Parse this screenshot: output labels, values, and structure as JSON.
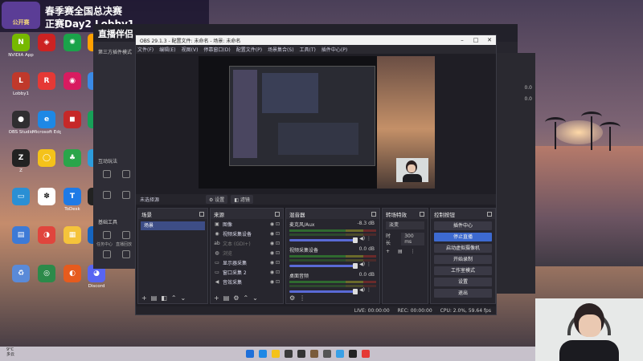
{
  "overlay": {
    "logo_text": "公开赛",
    "title_line1": "春季赛全国总决赛",
    "title_line2": "正赛Day2 Lobby1"
  },
  "desktop_icons": [
    {
      "label": "NVIDIA App",
      "color": "#76b900",
      "glyph": "N"
    },
    {
      "label": "Lobby1",
      "color": "#c0392b",
      "glyph": "L"
    },
    {
      "label": "OBS Studio",
      "color": "#302e31",
      "glyph": "●"
    },
    {
      "label": "Z",
      "color": "#222222",
      "glyph": "Z"
    },
    {
      "label": "",
      "color": "#2a8fd4",
      "glyph": "▭"
    },
    {
      "label": "",
      "color": "#3d7ad6",
      "glyph": "▤"
    },
    {
      "label": "",
      "color": "#5a8ad8",
      "glyph": "♻"
    },
    {
      "label": "",
      "color": "#cc2222",
      "glyph": "◈"
    },
    {
      "label": "",
      "color": "#e53935",
      "glyph": "R"
    },
    {
      "label": "Microsoft Edge",
      "color": "#1e88e5",
      "glyph": "e"
    },
    {
      "label": "",
      "color": "#f4c21a",
      "glyph": "◯"
    },
    {
      "label": "",
      "color": "#ffffff",
      "glyph": "✽"
    },
    {
      "label": "",
      "color": "#e0453d",
      "glyph": "◑"
    },
    {
      "label": "",
      "color": "#2c8a4a",
      "glyph": "◎"
    },
    {
      "label": "",
      "color": "#1aa34a",
      "glyph": "✺"
    },
    {
      "label": "",
      "color": "#d81b60",
      "glyph": "◉"
    },
    {
      "label": "",
      "color": "#c62828",
      "glyph": "◼"
    },
    {
      "label": "",
      "color": "#2aa54a",
      "glyph": "♣"
    },
    {
      "label": "ToDesk",
      "color": "#1e7ae6",
      "glyph": "T"
    },
    {
      "label": "",
      "color": "#f5c33b",
      "glyph": "▦"
    },
    {
      "label": "",
      "color": "#e65b1e",
      "glyph": "◐"
    },
    {
      "label": "",
      "color": "#ffa000",
      "glyph": "★"
    },
    {
      "label": "",
      "color": "#3a8ae6",
      "glyph": "K"
    },
    {
      "label": "",
      "color": "#18a058",
      "glyph": "▩"
    },
    {
      "label": "",
      "color": "#2d9cdb",
      "glyph": "◆"
    },
    {
      "label": "",
      "color": "#222222",
      "glyph": "◒"
    },
    {
      "label": "",
      "color": "#1565c0",
      "glyph": "◀"
    },
    {
      "label": "Discord",
      "color": "#5865f2",
      "glyph": "◕"
    }
  ],
  "bg_app": {
    "logo": "直播伴侣",
    "menu_label": "第三方插件模式",
    "section_interact": "互动玩法",
    "section_tools": "基础工具",
    "tool_labels": [
      "任务中心",
      "直播回放"
    ]
  },
  "obs": {
    "title": "OBS 29.1.3 - 配置文件: 未命名 - 场景: 未命名",
    "menu": [
      "文件(F)",
      "编辑(E)",
      "视图(V)",
      "停靠窗口(D)",
      "配置文件(P)",
      "场景集合(S)",
      "工具(T)",
      "插件中心(P)"
    ],
    "status_strip": {
      "label": "未选择源",
      "settings": "设置",
      "filters": "滤镜"
    },
    "scenes": {
      "header": "场景",
      "items": [
        "场景"
      ]
    },
    "sources": {
      "header": "来源",
      "items": [
        {
          "icon": "image-icon",
          "glyph": "▣",
          "name": "图像",
          "dim": false
        },
        {
          "icon": "camera-icon",
          "glyph": "◉",
          "name": "视频采集设备",
          "dim": false
        },
        {
          "icon": "text-icon",
          "glyph": "ab",
          "name": "文本 (GDI+)",
          "dim": true
        },
        {
          "icon": "browser-icon",
          "glyph": "◍",
          "name": "浏览",
          "dim": true
        },
        {
          "icon": "monitor-icon",
          "glyph": "▭",
          "name": "显示器采集",
          "dim": false
        },
        {
          "icon": "window-icon",
          "glyph": "▭",
          "name": "窗口采集 2",
          "dim": false
        },
        {
          "icon": "speaker-icon",
          "glyph": "◀",
          "name": "音效采集",
          "dim": false
        }
      ]
    },
    "mixer": {
      "header": "混音器",
      "channels": [
        {
          "name": "麦克风/Aux",
          "db": "-8.3 dB"
        },
        {
          "name": "视频采集设备",
          "db": "0.0 dB"
        },
        {
          "name": "桌面音频",
          "db": "0.0 dB"
        }
      ]
    },
    "transitions": {
      "header": "转场特效",
      "selected": "淡变",
      "duration_label": "时长",
      "duration_value": "300 ms"
    },
    "controls": {
      "header": "控制按钮",
      "buttons": [
        {
          "label": "插件中心",
          "active": false
        },
        {
          "label": "停止直播",
          "active": true
        },
        {
          "label": "启动虚拟摄像机",
          "active": false
        },
        {
          "label": "开始录制",
          "active": false
        },
        {
          "label": "工作室模式",
          "active": false
        },
        {
          "label": "设置",
          "active": false
        },
        {
          "label": "退出",
          "active": false
        }
      ]
    },
    "status_bar": {
      "live": "LIVE: 00:00:00",
      "rec": "REC: 00:00:00",
      "cpu": "CPU: 2.0%, 59.64 fps"
    }
  },
  "right_win": {
    "values": [
      "0.0",
      "0.0"
    ]
  },
  "taskbar": {
    "weather_temp": "9°C",
    "weather_desc": "多云",
    "icons": [
      "#1e88e5",
      "#f4c21a",
      "#3a3a3a",
      "#333333",
      "#7a5c3c",
      "#555555",
      "#3aa0e6",
      "#222222",
      "#e53935"
    ]
  }
}
